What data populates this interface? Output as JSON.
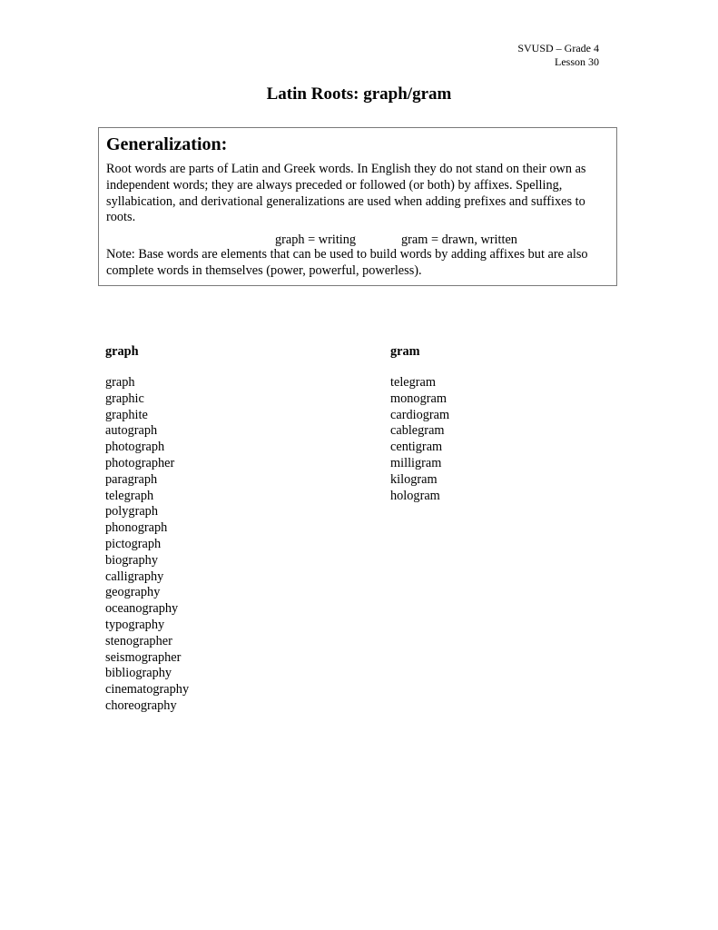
{
  "header": {
    "line1": "SVUSD – Grade 4",
    "line2": "Lesson 30"
  },
  "title": "Latin Roots: graph/gram",
  "generalization": {
    "heading": "Generalization:",
    "paragraph": "Root words are parts of Latin and Greek words.  In English they do not stand on their own as independent words; they are always preceded or followed (or both) by affixes.  Spelling, syllabication, and derivational generalizations are used when adding prefixes and suffixes to roots.",
    "definitions": [
      "graph = writing",
      "gram = drawn, written"
    ],
    "note": "Note: Base words are elements that can be used to build words by adding affixes but are also complete words in themselves (power, powerful, powerless)."
  },
  "columns": [
    {
      "heading": "graph",
      "words": [
        "graph",
        "graphic",
        "graphite",
        "autograph",
        "photograph",
        "photographer",
        "paragraph",
        "telegraph",
        "polygraph",
        "phonograph",
        "pictograph",
        "biography",
        "calligraphy",
        "geography",
        "oceanography",
        "typography",
        "stenographer",
        "seismographer",
        "bibliography",
        "cinematography",
        "choreography"
      ]
    },
    {
      "heading": "gram",
      "words": [
        "telegram",
        "monogram",
        "cardiogram",
        "cablegram",
        "centigram",
        "milligram",
        "kilogram",
        "hologram"
      ]
    }
  ]
}
